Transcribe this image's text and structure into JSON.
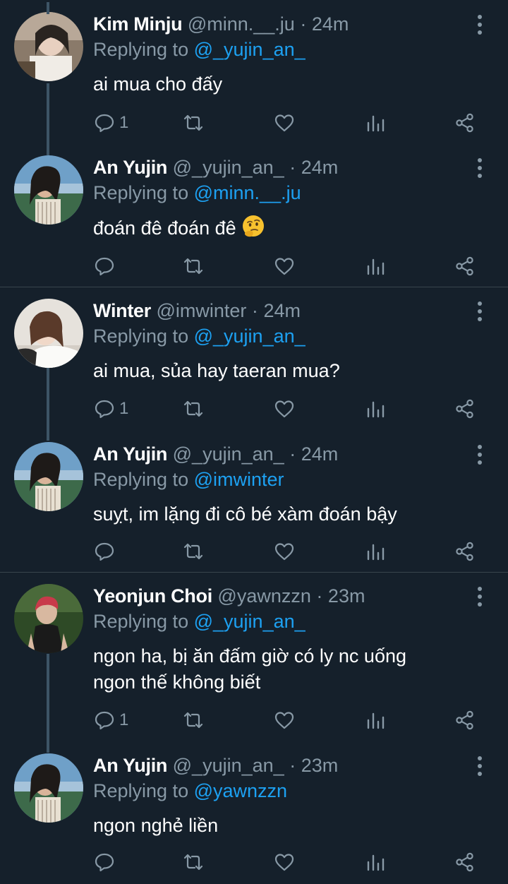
{
  "colors": {
    "background": "#15202b",
    "name": "#ffffff",
    "meta": "#8899a6",
    "mention": "#1da1f2",
    "divider": "#38444d"
  },
  "icons": [
    "reply-icon",
    "retweet-icon",
    "like-icon",
    "analytics-icon",
    "share-icon",
    "more-icon",
    "thinking-face-emoji"
  ],
  "tweets": [
    {
      "name": "Kim Minju",
      "handle": "@minn.__.ju",
      "sep": "·",
      "time": "24m",
      "replying_label": "Replying to",
      "replying_to": "@_yujin_an_",
      "text": "ai mua cho đấy",
      "reply_count": "1"
    },
    {
      "name": "An Yujin",
      "handle": "@_yujin_an_",
      "sep": "·",
      "time": "24m",
      "replying_label": "Replying to",
      "replying_to": "@minn.__.ju",
      "text": "đoán đê đoán đê",
      "reply_count": ""
    },
    {
      "name": "Winter",
      "handle": "@imwinter",
      "sep": "·",
      "time": "24m",
      "replying_label": "Replying to",
      "replying_to": "@_yujin_an_",
      "text": "ai mua, sủa hay taeran mua?",
      "reply_count": "1"
    },
    {
      "name": "An Yujin",
      "handle": "@_yujin_an_",
      "sep": "·",
      "time": "24m",
      "replying_label": "Replying to",
      "replying_to": "@imwinter",
      "text": "suỵt, im lặng đi cô bé xàm đoán bậy",
      "reply_count": ""
    },
    {
      "name": "Yeonjun Choi",
      "handle": "@yawnzzn",
      "sep": "·",
      "time": "23m",
      "replying_label": "Replying to",
      "replying_to": "@_yujin_an_",
      "text": "ngon ha, bị ăn đấm giờ có ly nc uống ngon thế không biết",
      "reply_count": "1"
    },
    {
      "name": "An Yujin",
      "handle": "@_yujin_an_",
      "sep": "·",
      "time": "23m",
      "replying_label": "Replying to",
      "replying_to": "@yawnzzn",
      "text": "ngon nghẻ liền",
      "reply_count": ""
    }
  ]
}
